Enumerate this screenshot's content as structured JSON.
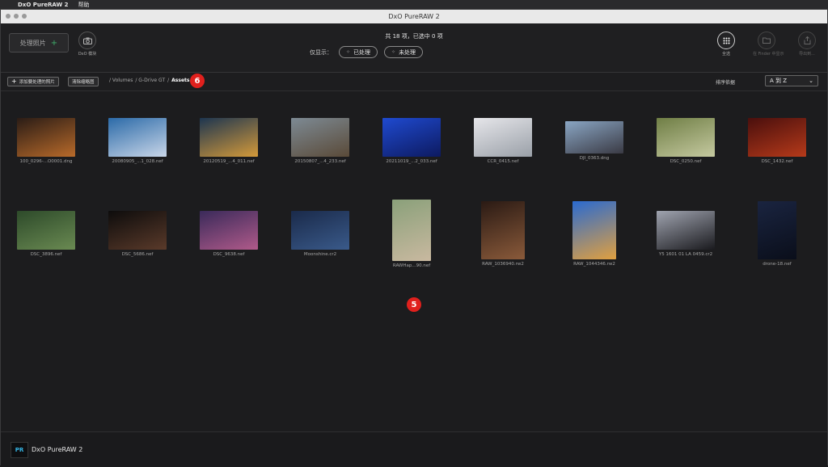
{
  "menubar": {
    "apple": "",
    "app_name": "DxO PureRAW 2",
    "menu_help": "帮助"
  },
  "window": {
    "title": "DxO PureRAW 2"
  },
  "toolbar": {
    "process_label": "处理照片",
    "process_plus": "+",
    "module_label": "DxO 模块",
    "count_text": "共 18 项，已选中 0 项",
    "filter_label": "仅显示：",
    "filter_processed": "已处理",
    "filter_unprocessed": "未处理",
    "select_all_label": "全选",
    "finder_label": "在 Finder 中显示",
    "export_label": "导出到..."
  },
  "crumbbar": {
    "add_button": "添加要处理的照片",
    "clear_button": "清除缩略图",
    "path": [
      "/ Volumes",
      "/ G-Drive GT",
      "/"
    ],
    "current": "Assets",
    "marker_6": "6",
    "sort_label": "排序依据",
    "sort_value": "A 到 Z"
  },
  "grid": {
    "marker_5": "5",
    "photos": [
      {
        "name": "100_0296-...O0001.dng",
        "colors": [
          "#2a1c16",
          "#b86a2a"
        ]
      },
      {
        "name": "20080905_...1_028.nef",
        "colors": [
          "#2b6aa8",
          "#c9d6e8"
        ]
      },
      {
        "name": "20120519_...4_011.nef",
        "colors": [
          "#1d3550",
          "#d49a3a"
        ]
      },
      {
        "name": "20150807_...4_233.nef",
        "colors": [
          "#7d8a94",
          "#5a4a38"
        ]
      },
      {
        "name": "20211019_...2_033.nef",
        "colors": [
          "#1f4ad0",
          "#0d1a60"
        ]
      },
      {
        "name": "CCR_0415.nef",
        "colors": [
          "#e6e6ea",
          "#9aa0a8"
        ]
      },
      {
        "name": "DJI_0363.dng",
        "colors": [
          "#8aa6c4",
          "#3a3a44"
        ]
      },
      {
        "name": "DSC_0250.nef",
        "colors": [
          "#6f7e45",
          "#c5c9a0"
        ]
      },
      {
        "name": "DSC_1432.nef",
        "colors": [
          "#4a0f0d",
          "#b63a1a"
        ]
      },
      {
        "name": "DSC_3896.nef",
        "colors": [
          "#2d4a2a",
          "#6a8a52"
        ]
      },
      {
        "name": "DSC_5686.nef",
        "colors": [
          "#0d0c0c",
          "#5a3a2a"
        ]
      },
      {
        "name": "DSC_9638.nef",
        "colors": [
          "#3a2a5a",
          "#b05a8a"
        ]
      },
      {
        "name": "Moonshine.cr2",
        "colors": [
          "#1a2a4a",
          "#3a5a8a"
        ]
      },
      {
        "name": "RAWHap...90.nef",
        "colors": [
          "#8aa07a",
          "#c9b9a0"
        ]
      },
      {
        "name": "RAW_1036940.rw2",
        "colors": [
          "#2a1a14",
          "#8a5a3a"
        ]
      },
      {
        "name": "RAW_1044346.rw2",
        "colors": [
          "#2a6ad0",
          "#e0a040"
        ]
      },
      {
        "name": "Y5 1601 01 LA 0459.cr2",
        "colors": [
          "#a0a4b0",
          "#1a1a1e"
        ]
      },
      {
        "name": "drone-18.nef",
        "colors": [
          "#1a2440",
          "#0a0e1a"
        ]
      }
    ]
  },
  "footer": {
    "logo_text": "PR",
    "app_name": "DxO PureRAW 2"
  }
}
